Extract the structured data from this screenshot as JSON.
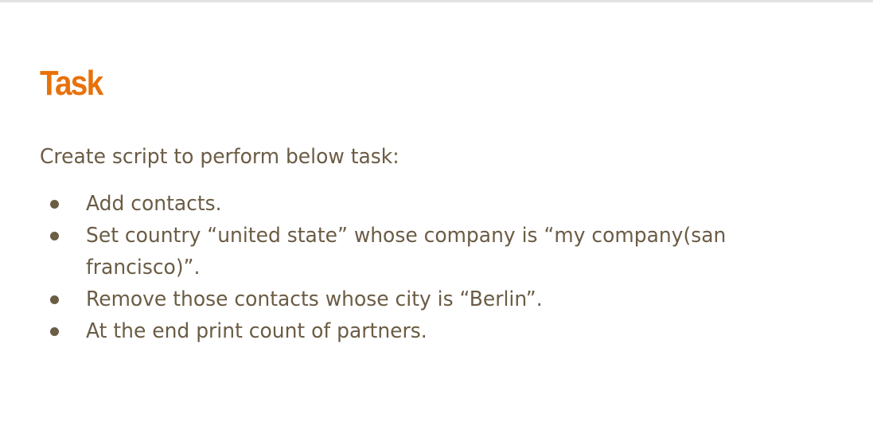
{
  "slide": {
    "title": "Task",
    "intro": "Create script to perform below task:",
    "bullets": [
      "Add contacts.",
      "Set country  “united state”  whose company is “my company(san francisco)”.",
      "Remove those contacts whose city is “Berlin”.",
      "At the end print count of partners."
    ]
  },
  "colors": {
    "title": "#e8710a",
    "body_text": "#6b5c45",
    "top_border": "#e3e3e3"
  }
}
